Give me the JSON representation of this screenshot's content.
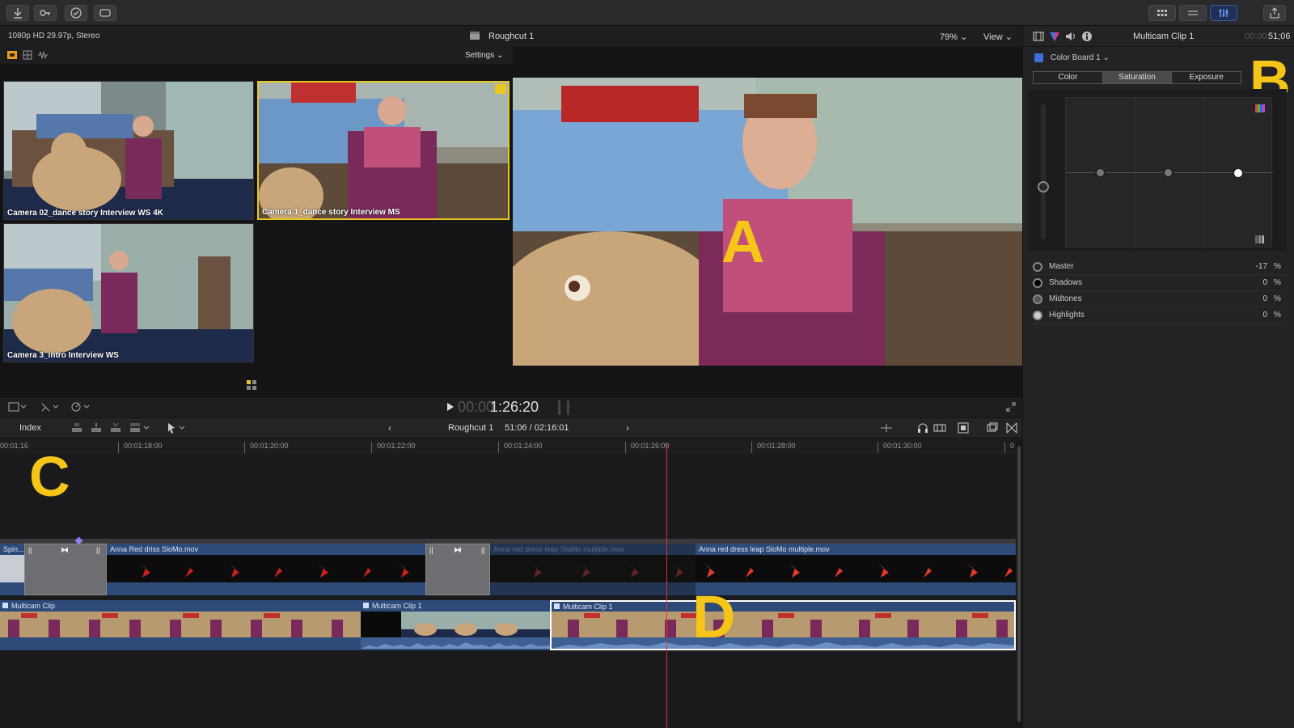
{
  "toolbar": {
    "import_icon": "download-icon",
    "keyword_icon": "key-icon",
    "check_icon": "checkmark-icon",
    "tag_icon": "tag-icon",
    "share_icon": "share-icon"
  },
  "angle_viewer": {
    "format": "1080p HD 29.97p, Stereo",
    "settings_label": "Settings",
    "angles": [
      {
        "label": "Camera 02_dance story Interview WS 4K"
      },
      {
        "label": "Camera 1_dance story Interview MS"
      },
      {
        "label": "Camera 3_intro Interview WS"
      }
    ]
  },
  "viewer": {
    "title": "Roughcut 1",
    "zoom": "79%",
    "view_label": "View",
    "timecode_dim": "00:00",
    "timecode": "1:26:20"
  },
  "inspector": {
    "clip_name": "Multicam Clip 1",
    "duration_dim": "00:00:",
    "duration": "51;06",
    "color_board": "Color Board 1",
    "tabs": [
      "Color",
      "Saturation",
      "Exposure"
    ],
    "active_tab": "Saturation",
    "params": [
      {
        "name": "Master",
        "value": "-17",
        "unit": "%"
      },
      {
        "name": "Shadows",
        "value": "0",
        "unit": "%"
      },
      {
        "name": "Midtones",
        "value": "0",
        "unit": "%"
      },
      {
        "name": "Highlights",
        "value": "0",
        "unit": "%"
      }
    ]
  },
  "timeline": {
    "index_label": "Index",
    "project": "Roughcut 1",
    "position": "51:06 / 02:16:01",
    "ruler": [
      "00:01:16",
      "00:01:18:00",
      "00:01:20:00",
      "00:01:22:00",
      "00:01:24:00",
      "00:01:26:00",
      "00:01:28:00",
      "00:01:30:00",
      "0"
    ],
    "upper_clips": [
      {
        "title": "Spin..."
      },
      {
        "title": "Anna Red driss SloMo.mov"
      },
      {
        "title": "Anna red dress leap SloMo multiple.mov"
      },
      {
        "title": "Anna red dress leap SloMo multiple.mov"
      }
    ],
    "lower_clips": [
      {
        "title": "Multicam Clip"
      },
      {
        "title": "Multicam Clip 1"
      },
      {
        "title": "Multicam Clip 1"
      }
    ]
  },
  "letters": {
    "a": "A",
    "b": "B",
    "c": "C",
    "d": "D"
  },
  "colors": {
    "accent_yellow": "#e8c820",
    "playhead": "#d9342b",
    "clip_blue": "#2e4a78"
  }
}
